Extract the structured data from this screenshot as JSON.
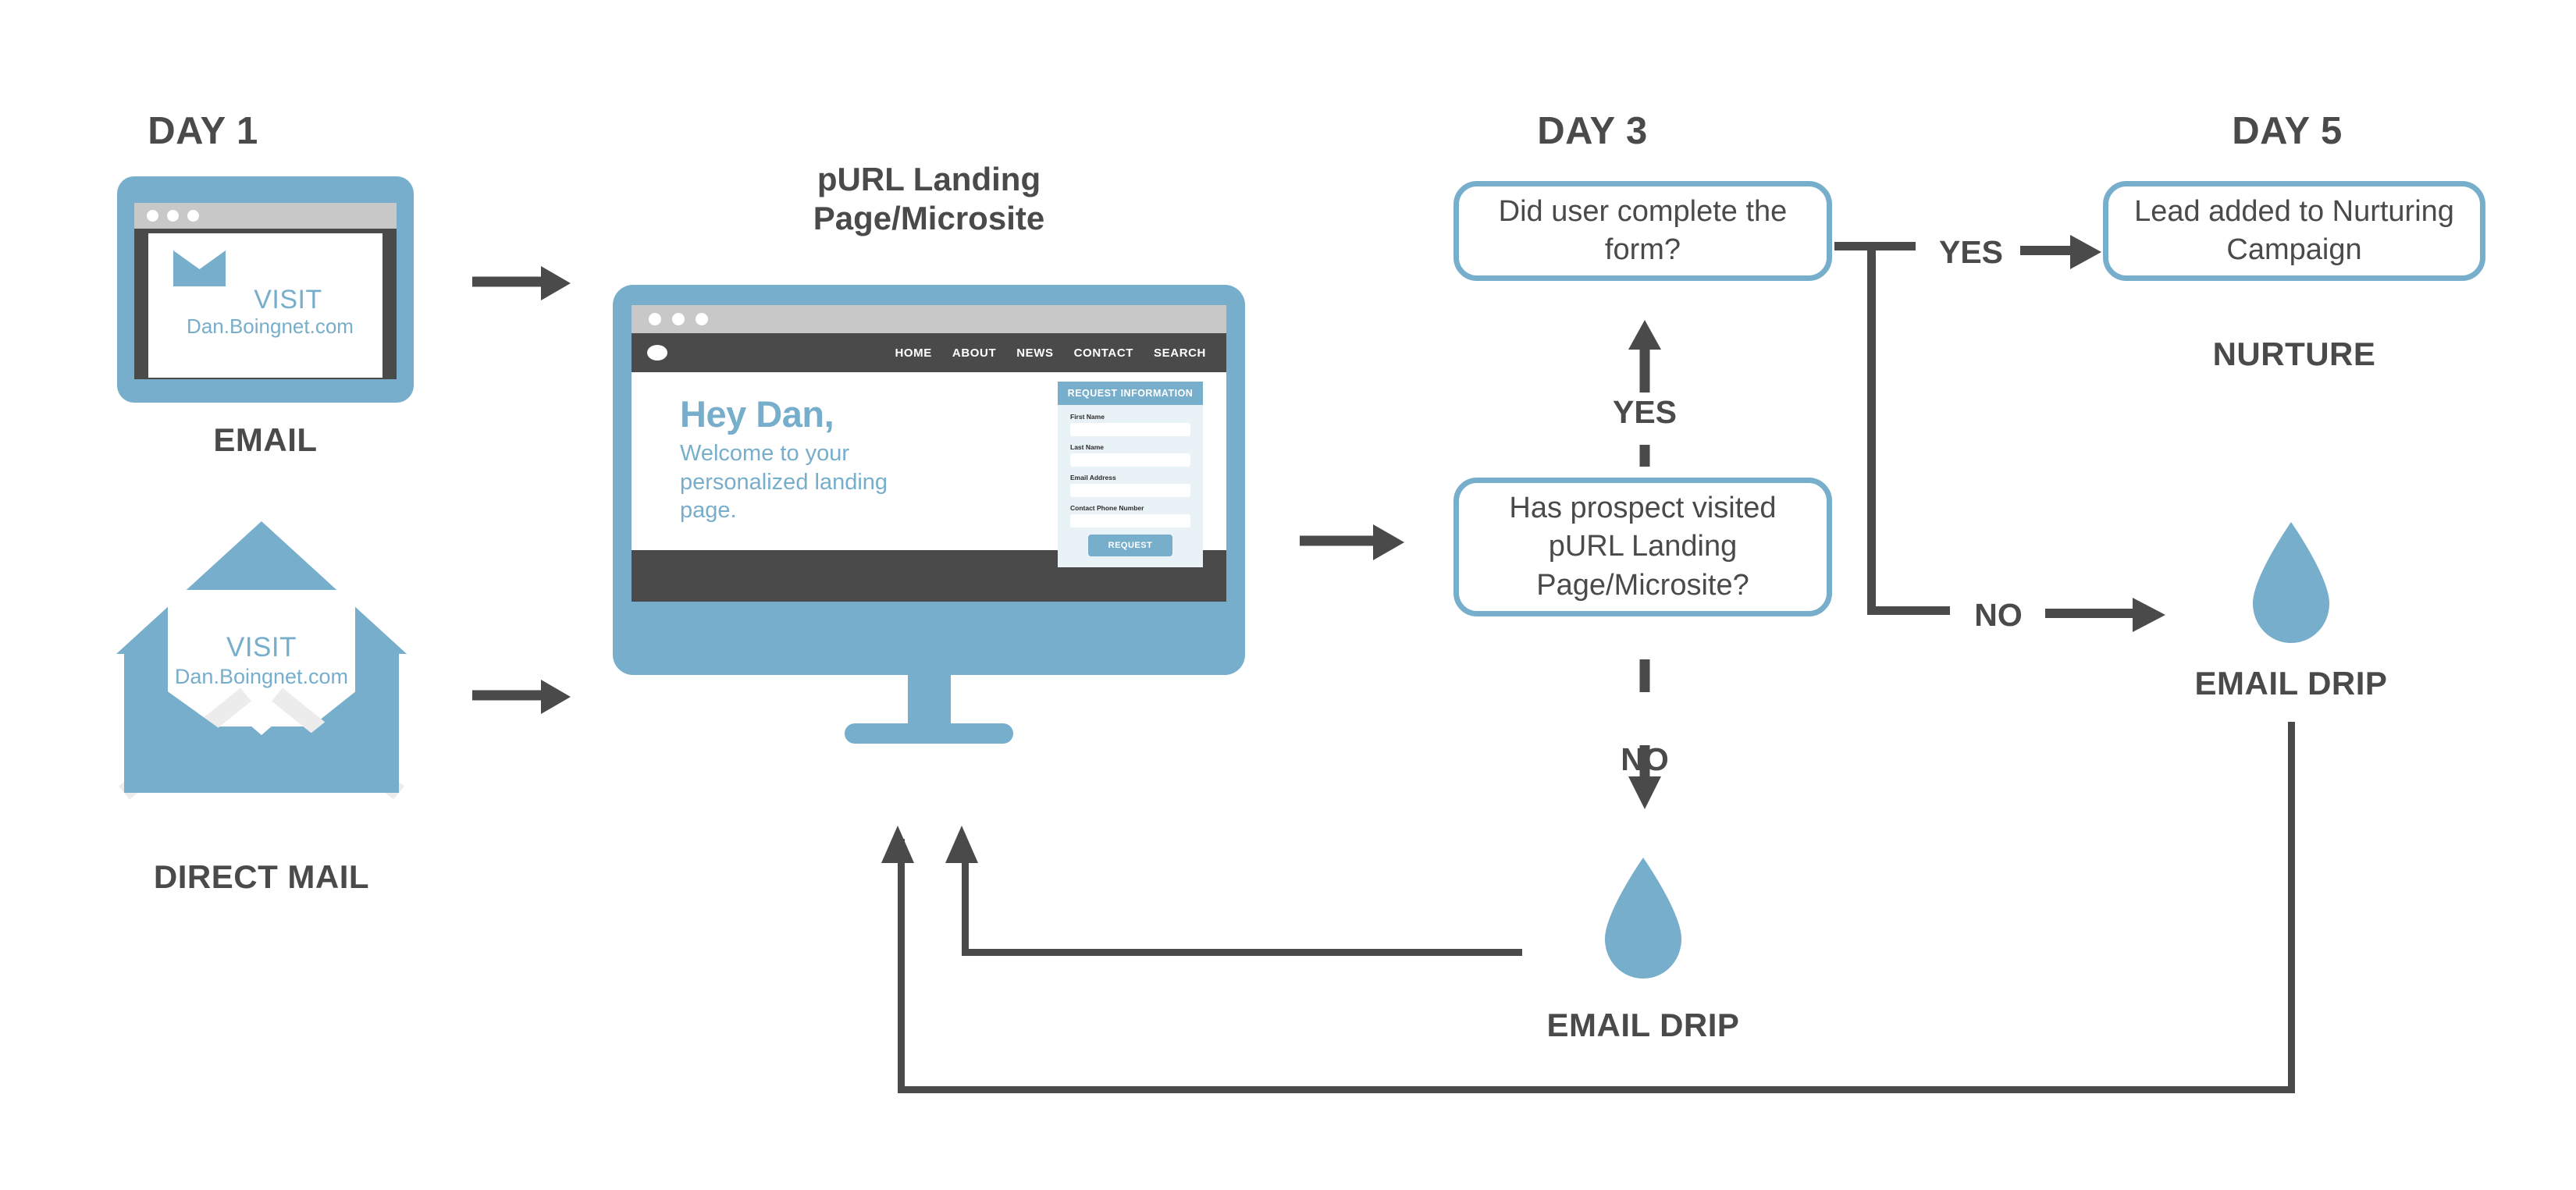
{
  "theme": {
    "blue": "#76aecb",
    "dark_gray": "#4a4a4a",
    "light_gray": "#c8c8c8",
    "form_bg": "#e9f2f6",
    "white": "#ffffff"
  },
  "columns": {
    "day1": {
      "title": "DAY 1"
    },
    "day3": {
      "title": "DAY 3"
    },
    "day5": {
      "title": "DAY 5"
    }
  },
  "email_channel": {
    "caption": "EMAIL",
    "visit_label": "VISIT",
    "purl": "Dan.Boingnet.com",
    "icon": "envelope-icon"
  },
  "direct_mail_channel": {
    "caption": "DIRECT MAIL",
    "visit_label": "VISIT",
    "purl": "Dan.Boingnet.com",
    "icon": "open-envelope-icon"
  },
  "landing_page": {
    "title_line1": "pURL Landing",
    "title_line2": "Page/Microsite",
    "nav": [
      "HOME",
      "ABOUT",
      "NEWS",
      "CONTACT",
      "SEARCH"
    ],
    "headline": "Hey Dan,",
    "subhead": "Welcome to your personalized landing page.",
    "form": {
      "header": "REQUEST INFORMATION",
      "fields": [
        {
          "label": "First Name",
          "value": ""
        },
        {
          "label": "Last Name",
          "value": ""
        },
        {
          "label": "Email Address",
          "value": ""
        },
        {
          "label": "Contact Phone Number",
          "value": ""
        }
      ],
      "submit_label": "REQUEST"
    }
  },
  "decisions": {
    "visited": "Has prospect visited pURL Landing Page/Microsite?",
    "completed_form": "Did user complete the form?"
  },
  "outcome": {
    "text": "Lead added to Nurturing Campaign",
    "caption": "NURTURE"
  },
  "drips": {
    "bottom": {
      "caption": "EMAIL DRIP",
      "icon": "water-drop-icon"
    },
    "right": {
      "caption": "EMAIL DRIP",
      "icon": "water-drop-icon"
    }
  },
  "edge_labels": {
    "visited_yes": "YES",
    "visited_no": "NO",
    "form_yes": "YES",
    "form_no": "NO"
  }
}
